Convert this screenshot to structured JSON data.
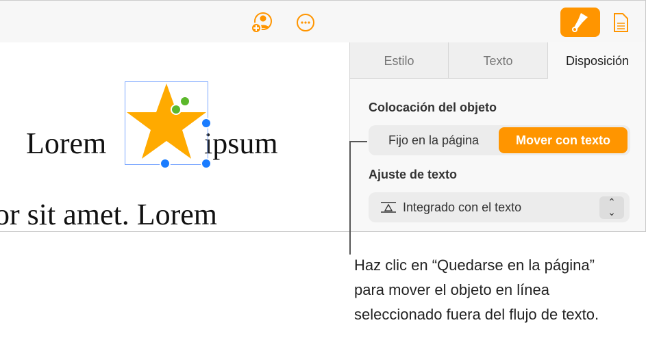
{
  "toolbar": {
    "icons": [
      "collaborate-icon",
      "more-icon",
      "format-brush-icon",
      "document-icon"
    ]
  },
  "document": {
    "word1": "Lorem",
    "word2": "ipsum",
    "line2": "or sit amet. Lorem"
  },
  "panel": {
    "tabs": [
      {
        "label": "Estilo"
      },
      {
        "label": "Texto"
      },
      {
        "label": "Disposición",
        "active": true
      }
    ],
    "placement_heading": "Colocación del objeto",
    "placement_options": [
      "Fijo en la página",
      "Mover con texto"
    ],
    "placement_selected": "Mover con texto",
    "wrap_heading": "Ajuste de texto",
    "wrap_value": "Integrado con el texto"
  },
  "callout": "Haz clic en “Quedarse en la página” para mover el objeto en línea seleccionado fuera del flujo de texto.",
  "colors": {
    "accent": "#ff9500",
    "selection": "#1a7cff"
  }
}
